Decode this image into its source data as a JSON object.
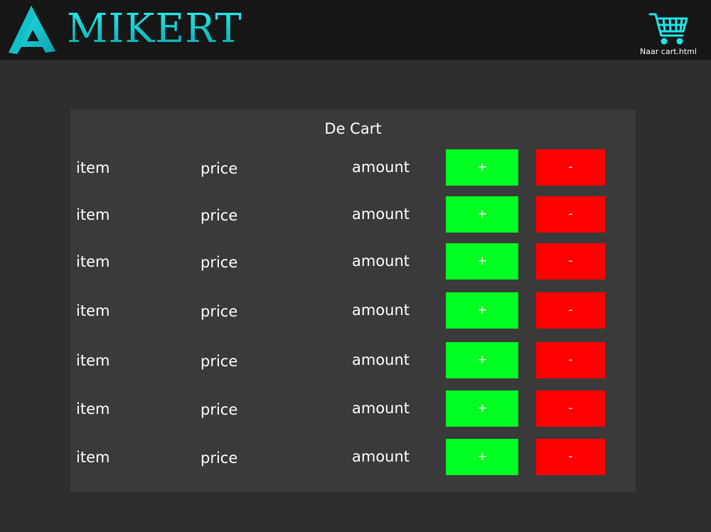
{
  "header": {
    "brand": "MIKERT",
    "cart_link_label": "Naar cart.html"
  },
  "cart": {
    "title": "De Cart",
    "rows": [
      {
        "item": "item",
        "price": "price",
        "amount": "amount",
        "plus": "+",
        "minus": "-"
      },
      {
        "item": "item",
        "price": "price",
        "amount": "amount",
        "plus": "+",
        "minus": "-"
      },
      {
        "item": "item",
        "price": "price",
        "amount": "amount",
        "plus": "+",
        "minus": "-"
      },
      {
        "item": "item",
        "price": "price",
        "amount": "amount",
        "plus": "+",
        "minus": "-"
      },
      {
        "item": "item",
        "price": "price",
        "amount": "amount",
        "plus": "+",
        "minus": "-"
      },
      {
        "item": "item",
        "price": "price",
        "amount": "amount",
        "plus": "+",
        "minus": "-"
      },
      {
        "item": "item",
        "price": "price",
        "amount": "amount",
        "plus": "+",
        "minus": "-"
      }
    ]
  },
  "colors": {
    "brand": "#1ad8dc",
    "plus_button": "#02ff22",
    "minus_button": "#ff0000"
  },
  "icons": {
    "logo": "triangle-logo-icon",
    "cart": "shopping-cart-icon"
  }
}
